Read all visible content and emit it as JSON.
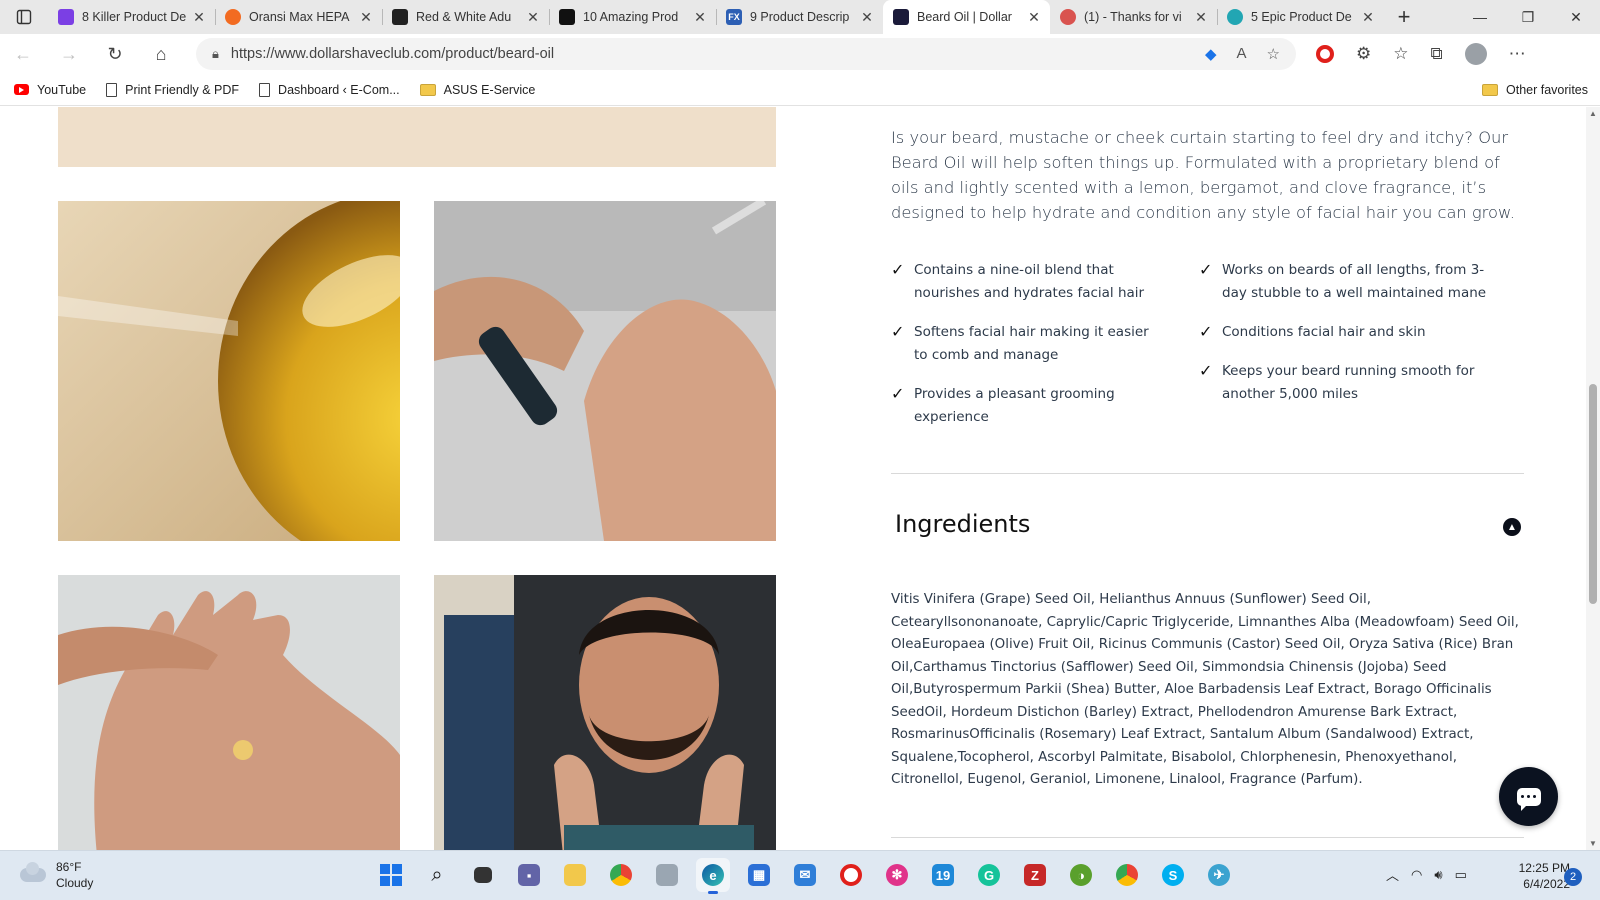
{
  "browser": {
    "tabs": [
      {
        "title": "8 Killer Product De",
        "favicon_color": "#7b3fe4"
      },
      {
        "title": "Oransi Max HEPA",
        "favicon_color": "#f26b21"
      },
      {
        "title": "Red & White Adu",
        "favicon_color": "#222222"
      },
      {
        "title": "10 Amazing Prod",
        "favicon_color": "#111111"
      },
      {
        "title": "9 Product Descrip",
        "favicon_color": "#2d5fb4"
      },
      {
        "title": "Beard Oil | Dollar",
        "favicon_color": "#1b1b3a"
      },
      {
        "title": "(1) - Thanks for vi",
        "favicon_color": "#d9534f"
      },
      {
        "title": "5 Epic Product De",
        "favicon_color": "#22a6b3"
      }
    ],
    "fav_letters": [
      "",
      "",
      "",
      "",
      "FX",
      "",
      "",
      ""
    ],
    "url": "https://www.dollarshaveclub.com/product/beard-oil",
    "bookmarks": [
      {
        "label": "YouTube"
      },
      {
        "label": "Print Friendly & PDF"
      },
      {
        "label": "Dashboard ‹ E-Com..."
      },
      {
        "label": "ASUS E-Service"
      }
    ],
    "other_favorites": "Other favorites"
  },
  "product": {
    "description": "Is your beard, mustache or cheek curtain starting to feel dry and itchy? Our Beard Oil will help soften things up. Formulated with a proprietary blend of oils and lightly scented with a lemon, bergamot, and clove fragrance, it’s designed to help hydrate and condition any style of facial hair you can grow.",
    "benefits_left": [
      "Contains a nine-oil blend that nourishes and hydrates facial hair",
      "Softens facial hair making it easier to comb and manage",
      "Provides a pleasant grooming experience"
    ],
    "benefits_right": [
      "Works on beards of all lengths, from 3-day stubble to a well maintained mane",
      "Conditions facial hair and skin",
      "Keeps your beard running smooth for another 5,000 miles"
    ],
    "ingredients_title": "Ingredients",
    "ingredients": "Vitis Vinifera (Grape) Seed Oil, Helianthus Annuus (Sunflower) Seed Oil, Cetearyllsononanoate, Caprylic/Capric Triglyceride, Limnanthes Alba (Meadowfoam) Seed Oil, OleaEuropaea (Olive) Fruit Oil, Ricinus Communis (Castor) Seed Oil, Oryza Sativa (Rice) Bran Oil,Carthamus Tinctorius (Safflower) Seed Oil, Simmondsia Chinensis (Jojoba) Seed Oil,Butyrospermum Parkii (Shea) Butter, Aloe Barbadensis Leaf Extract, Borago Officinalis SeedOil, Hordeum Distichon (Barley) Extract, Phellodendron Amurense Bark Extract, RosmarinusOfficinalis (Rosemary) Leaf Extract, Santalum Album (Sandalwood) Extract, Squalene,Tocopherol, Ascorbyl Palmitate, Bisabolol, Chlorphenesin, Phenoxyethanol, Citronellol, Eugenol, Geraniol, Limonene, Linalool, Fragrance (Parfum)."
  },
  "taskbar": {
    "temperature": "86°F",
    "condition": "Cloudy",
    "time": "12:25 PM",
    "date": "6/4/2022",
    "notifications": "2"
  },
  "colors": {
    "accent": "#0b1220",
    "text": "#2d3a4a",
    "beige_banner": "#efdfca"
  }
}
